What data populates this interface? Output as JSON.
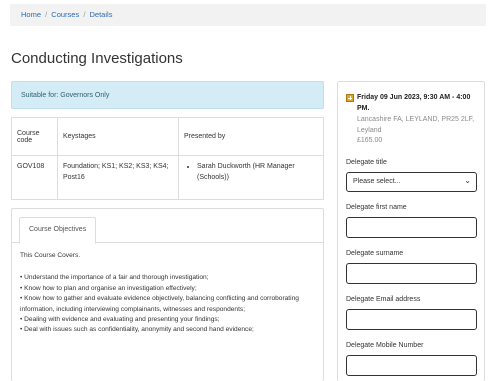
{
  "breadcrumb": {
    "home": "Home",
    "courses": "Courses",
    "details": "Details",
    "separator": "/"
  },
  "page_title": "Conducting Investigations",
  "alert": "Suitable for: Governors Only",
  "table": {
    "headers": [
      "Course code",
      "Keystages",
      "Presented by"
    ],
    "row": {
      "code": "GOV108",
      "keystages": "Foundation; KS1; KS2; KS3; KS4; Post16",
      "presenter": "Sarah Duckworth (HR Manager (Schools))"
    }
  },
  "tabs": {
    "objectives_label": "Course Objectives"
  },
  "objectives": {
    "intro": "This Course Covers.",
    "items": [
      "• Understand the importance of a fair and thorough investigation;",
      "• Know how to plan and organise an investigation effectively;",
      "• Know how to gather and evaluate evidence objectively, balancing conflicting and corroborating information, including interviewing complainants, witnesses and respondents;",
      "• Dealing with evidence and evaluating and presenting your findings;",
      "• Deal with issues such as confidentiality, anonymity and second hand evidence;"
    ]
  },
  "event": {
    "date": "Friday 09 Jun 2023, 9:30 AM - 4:00 PM.",
    "location": "Lancashire FA, LEYLAND, PR25 2LF, Leyland",
    "price": "£165.00"
  },
  "form": {
    "title_label": "Delegate title",
    "title_value": "Please select...",
    "first_name_label": "Delegate first name",
    "surname_label": "Delegate surname",
    "email_label": "Delegate Email address",
    "mobile_label": "Delegate Mobile Number"
  },
  "colors": {
    "link": "#2a6cb0",
    "alert_bg": "#d4ecf5",
    "icon": "#e0a520"
  }
}
